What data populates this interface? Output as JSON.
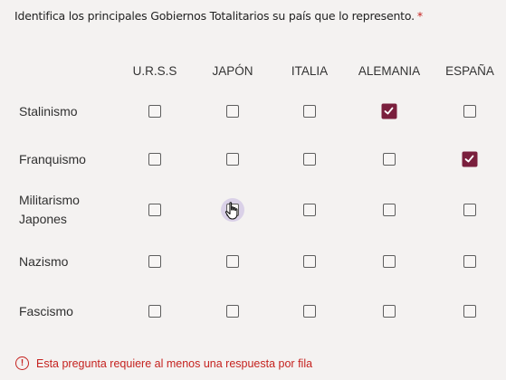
{
  "question": {
    "text": "Identifica los principales Gobiernos Totalitarios su país que lo represento.",
    "required_mark": "*"
  },
  "columns": [
    "U.R.S.S",
    "JAPÓN",
    "ITALIA",
    "ALEMANIA",
    "ESPAÑA"
  ],
  "rows": [
    {
      "label_lines": [
        "Stalinismo"
      ],
      "checked": [
        false,
        false,
        false,
        true,
        false
      ]
    },
    {
      "label_lines": [
        "Franquismo"
      ],
      "checked": [
        false,
        false,
        false,
        false,
        true
      ]
    },
    {
      "label_lines": [
        "Militarismo",
        "Japones"
      ],
      "checked": [
        false,
        false,
        false,
        false,
        false
      ]
    },
    {
      "label_lines": [
        "Nazismo"
      ],
      "checked": [
        false,
        false,
        false,
        false,
        false
      ]
    },
    {
      "label_lines": [
        "Fascismo"
      ],
      "checked": [
        false,
        false,
        false,
        false,
        false
      ]
    }
  ],
  "cursor": {
    "row": 2,
    "col": 1,
    "icon": "hand-pointer-icon"
  },
  "error": {
    "icon": "exclamation-icon",
    "text": "Esta pregunta requiere al menos una respuesta por fila"
  },
  "colors": {
    "accent": "#7a1f3d",
    "error": "#c5221f"
  }
}
